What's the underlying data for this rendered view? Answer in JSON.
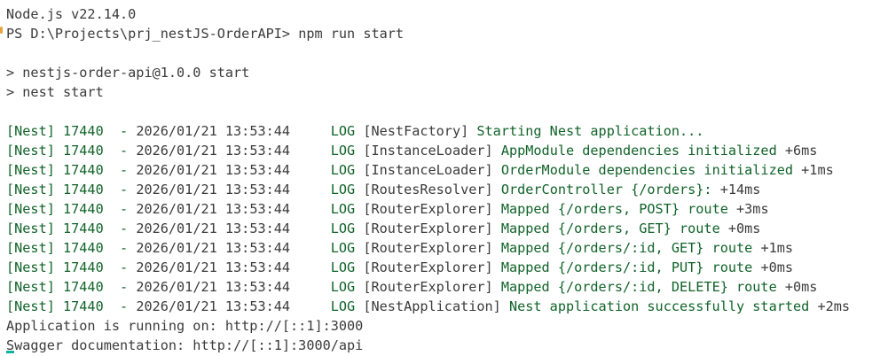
{
  "terminal": {
    "version_line": "Node.js v22.14.0",
    "prompt_path": "PS D:\\Projects\\prj_nestJS-OrderAPI>",
    "prompt_command": "npm run start",
    "npm_line_1": "> nestjs-order-api@1.0.0 start",
    "npm_line_2": "> nest start",
    "log_prefix": "[Nest] 17440  - ",
    "log_time": "2026/01/21 13:53:44",
    "log_level": "LOG",
    "logs": [
      {
        "context": "[NestFactory]",
        "message": "Starting Nest application..."
      },
      {
        "context": "[InstanceLoader]",
        "message": "AppModule dependencies initialized",
        "timing": "+6ms"
      },
      {
        "context": "[InstanceLoader]",
        "message": "OrderModule dependencies initialized",
        "timing": "+1ms"
      },
      {
        "context": "[RoutesResolver]",
        "message": "OrderController {/orders}:",
        "timing": "+14ms"
      },
      {
        "context": "[RouterExplorer]",
        "message": "Mapped {/orders, POST} route",
        "timing": "+3ms"
      },
      {
        "context": "[RouterExplorer]",
        "message": "Mapped {/orders, GET} route",
        "timing": "+0ms"
      },
      {
        "context": "[RouterExplorer]",
        "message": "Mapped {/orders/:id, GET} route",
        "timing": "+1ms"
      },
      {
        "context": "[RouterExplorer]",
        "message": "Mapped {/orders/:id, PUT} route",
        "timing": "+0ms"
      },
      {
        "context": "[RouterExplorer]",
        "message": "Mapped {/orders/:id, DELETE} route",
        "timing": "+0ms"
      },
      {
        "context": "[NestApplication]",
        "message": "Nest application successfully started",
        "timing": "+2ms"
      }
    ],
    "app_running": "Application is running on: http://[::1]:3000",
    "swagger_docs": "Swagger documentation: http://[::1]:3000/api"
  },
  "colors": {
    "background": "#ffffff",
    "text": "#3b3b3b",
    "log_green": "#116329",
    "decoration_marker": "#e8a33d",
    "cursor": "#0fb3a2"
  }
}
